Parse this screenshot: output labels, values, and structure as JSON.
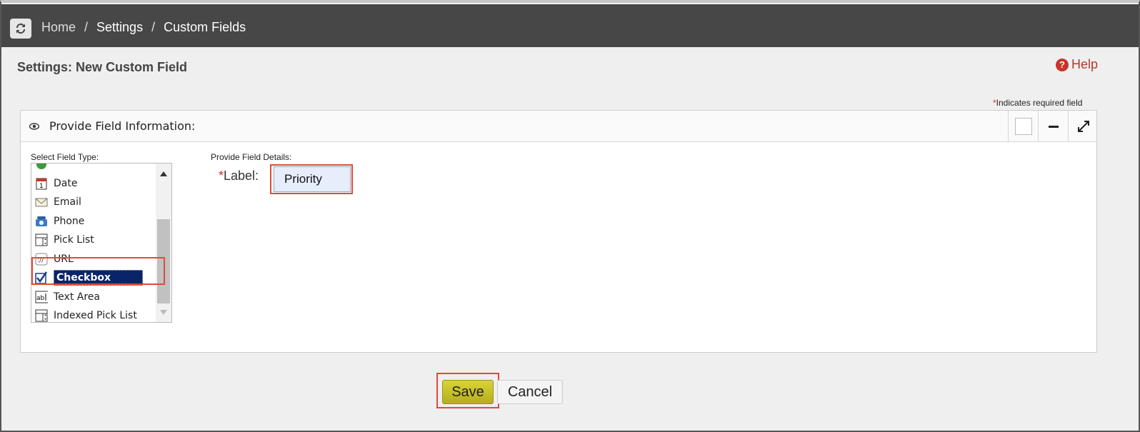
{
  "breadcrumb": [
    "Home",
    "Settings",
    "Custom Fields"
  ],
  "breadcrumb_separator": "/",
  "page_title": "Settings: New Custom Field",
  "help_label": "Help",
  "required_note": {
    "star": "*",
    "text": "Indicates required field"
  },
  "panel": {
    "title": "Provide Field Information:"
  },
  "field_type": {
    "label": "Select Field Type:",
    "items": [
      {
        "label": "",
        "icon": "circle-icon"
      },
      {
        "label": "Date",
        "icon": "calendar-icon"
      },
      {
        "label": "Email",
        "icon": "envelope-icon"
      },
      {
        "label": "Phone",
        "icon": "phone-icon"
      },
      {
        "label": "Pick List",
        "icon": "pick-list-icon"
      },
      {
        "label": "URL",
        "icon": "url-icon"
      },
      {
        "label": "Checkbox",
        "icon": "checkbox-icon",
        "selected": true
      },
      {
        "label": "Text Area",
        "icon": "text-area-icon"
      },
      {
        "label": "Indexed Pick List",
        "icon": "indexed-pick-list-icon"
      }
    ]
  },
  "details": {
    "label": "Provide Field Details:",
    "field_label": {
      "star": "*",
      "text": "Label:",
      "value": "Priority"
    }
  },
  "buttons": {
    "save": "Save",
    "cancel": "Cancel"
  },
  "colors": {
    "topbar": "#474747",
    "accent_highlight": "#e04a3a",
    "save_button": "#d2cc2e",
    "selected_item": "#0a246a",
    "help": "#b53b2c"
  }
}
